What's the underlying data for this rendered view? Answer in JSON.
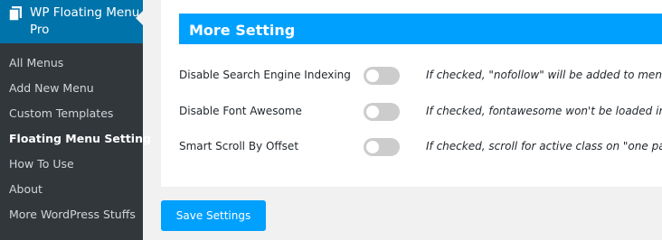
{
  "sidebar": {
    "title": "WP Floating Menu Pro",
    "items": [
      {
        "label": "All Menus"
      },
      {
        "label": "Add New Menu"
      },
      {
        "label": "Custom Templates"
      },
      {
        "label": "Floating Menu Setting"
      },
      {
        "label": "How To Use"
      },
      {
        "label": "About"
      },
      {
        "label": "More WordPress Stuffs"
      }
    ],
    "current_index": 3
  },
  "section": {
    "title": "More Setting"
  },
  "settings": [
    {
      "label": "Disable Search Engine Indexing",
      "enabled": false,
      "description": "If checked, \"nofollow\" will be added to menu"
    },
    {
      "label": "Disable Font Awesome",
      "enabled": false,
      "description": "If checked, fontawesome won't be loaded in"
    },
    {
      "label": "Smart Scroll By Offset",
      "enabled": false,
      "description": "If checked, scroll for active class on \"one pag"
    }
  ],
  "actions": {
    "save_label": "Save Settings"
  },
  "colors": {
    "accent": "#00a0ff",
    "sidebar_bg": "#23282d",
    "sidebar_active": "#0073aa",
    "toggle_off": "#cccccc"
  }
}
